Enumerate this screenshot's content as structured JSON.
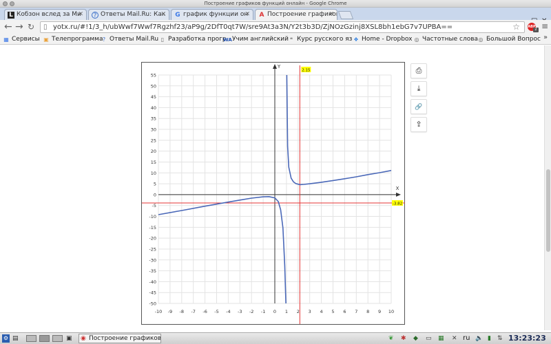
{
  "window": {
    "title": "Построение графиков функций онлайн - Google Chrome"
  },
  "tabs": [
    {
      "label": "Кобзон вслед за Ми",
      "icon": "L"
    },
    {
      "label": "Ответы Mail.Ru: Как",
      "icon": "?"
    },
    {
      "label": "график функции он",
      "icon": "G"
    },
    {
      "label": "Построение графиков",
      "icon": "A",
      "active": true
    }
  ],
  "toolbar": {
    "url": "yotx.ru/#!1/3_h/ubWwf7Wwf7Rgzhf23/aP9g/2DfT0qt7W/sre9At3a3N/Y2t3b3D/ZjNOzGzinj8XSL8bh1ebG7v7UPBA==",
    "abp_label": "ABP",
    "abp_count": "2"
  },
  "bookmarks": [
    {
      "label": "Сервисы",
      "icon": "grid-icon"
    },
    {
      "label": "Телепрограмма",
      "icon": "tv-icon"
    },
    {
      "label": "Ответы Mail.Ru",
      "icon": "question-icon"
    },
    {
      "label": "Разработка прогр",
      "icon": "page-icon"
    },
    {
      "label": "Учим английский",
      "icon": "wa-icon"
    },
    {
      "label": "Курс русского яз",
      "icon": "book-icon"
    },
    {
      "label": "Home - Dropbox",
      "icon": "dropbox-icon"
    },
    {
      "label": "Частотные слова",
      "icon": "globe-icon"
    },
    {
      "label": "Большой Вопрос",
      "icon": "globe-icon"
    }
  ],
  "graph": {
    "axis_x_label": "X",
    "axis_y_label": "Y",
    "vline_label": "2.15",
    "hline_label": "-3.82",
    "x_ticks": [
      "-10",
      "-9",
      "-8",
      "-7",
      "-6",
      "-5",
      "-4",
      "-3",
      "-2",
      "-1",
      "0",
      "1",
      "2",
      "3",
      "4",
      "5",
      "6",
      "7",
      "8",
      "9",
      "10"
    ],
    "y_ticks": [
      "55",
      "50",
      "45",
      "40",
      "35",
      "30",
      "25",
      "20",
      "15",
      "10",
      "5",
      "0",
      "-5",
      "-10",
      "-15",
      "-20",
      "-25",
      "-30",
      "-35",
      "-40",
      "-45",
      "-50"
    ]
  },
  "chart_data": {
    "type": "line",
    "x_range": [
      -10,
      10
    ],
    "y_range": [
      -52,
      57
    ],
    "series": [
      {
        "x": [
          -10,
          -8,
          -6,
          -4,
          -3,
          -2,
          -1,
          -0.5,
          0,
          0.3,
          0.5,
          0.7,
          0.85,
          0.95
        ],
        "y": [
          -9.2,
          -7.3,
          -5.3,
          -3.4,
          -2.5,
          -1.6,
          -1.0,
          -0.9,
          -1.5,
          -3.2,
          -7.0,
          -15.3,
          -32.4,
          -50
        ]
      },
      {
        "x": [
          1.03,
          1.1,
          1.2,
          1.4,
          1.6,
          1.8,
          2.0,
          2.15,
          2.5,
          3,
          4,
          5,
          6,
          7,
          8,
          9,
          10
        ],
        "y": [
          55,
          22.2,
          12.6,
          7.6,
          5.9,
          5.1,
          4.8,
          4.6,
          4.7,
          5.0,
          5.7,
          6.5,
          7.3,
          8.2,
          9.2,
          10.1,
          11.1
        ]
      }
    ],
    "vertical_marker": {
      "x": 2.15,
      "label": "2.15"
    },
    "horizontal_marker": {
      "y": -3.82,
      "label": "-3.82"
    },
    "xlabel": "X",
    "ylabel": "Y",
    "grid": true
  },
  "side_buttons": [
    {
      "icon": "print-icon",
      "glyph": "⎙"
    },
    {
      "icon": "download-icon",
      "glyph": "⤓"
    },
    {
      "icon": "link-icon",
      "glyph": "🔗"
    },
    {
      "icon": "share-icon",
      "glyph": "⇪"
    }
  ],
  "taskbar": {
    "app_label": "Построение графиков",
    "lang": "ru",
    "clock": "13:23:23"
  },
  "colors": {
    "curve": "#4a68b8",
    "marker": "#e53333",
    "marker_label_bg": "#ffff00",
    "grid": "#e3e3e3"
  }
}
